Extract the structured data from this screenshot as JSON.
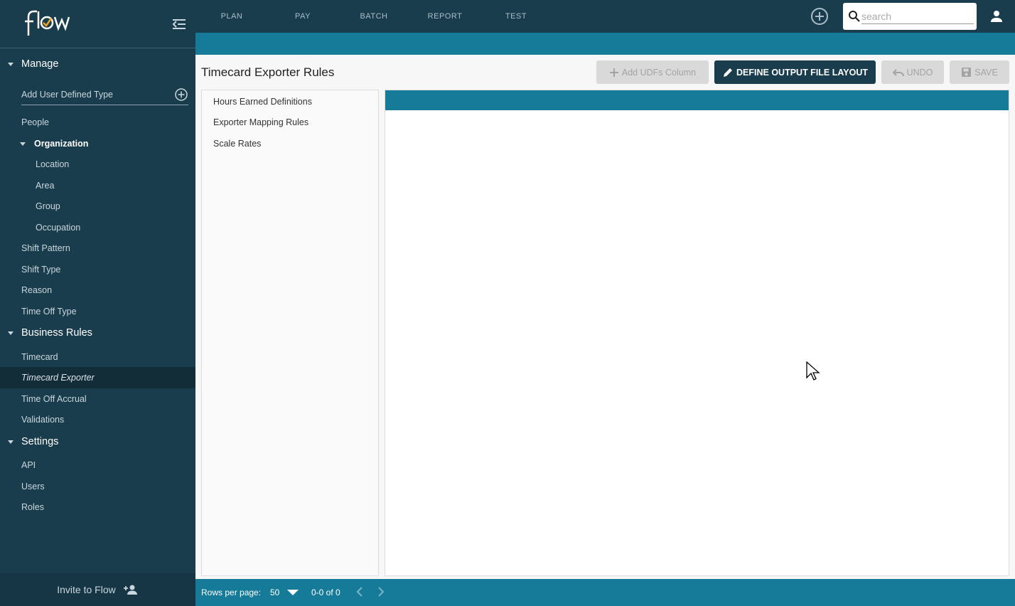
{
  "app": {
    "logo_text": "flow"
  },
  "sidebar": {
    "sections": [
      {
        "label": "Manage"
      },
      {
        "label": "Business Rules"
      },
      {
        "label": "Settings"
      }
    ],
    "add_udt_label": "Add User Defined Type",
    "manage_items": [
      {
        "label": "People"
      },
      {
        "label": "Organization"
      },
      {
        "label": "Location"
      },
      {
        "label": "Area"
      },
      {
        "label": "Group"
      },
      {
        "label": "Occupation"
      },
      {
        "label": "Shift Pattern"
      },
      {
        "label": "Shift Type"
      },
      {
        "label": "Reason"
      },
      {
        "label": "Time Off Type"
      }
    ],
    "business_items": [
      {
        "label": "Timecard"
      },
      {
        "label": "Timecard Exporter"
      },
      {
        "label": "Time Off Accrual"
      },
      {
        "label": "Validations"
      }
    ],
    "settings_items": [
      {
        "label": "API"
      },
      {
        "label": "Users"
      },
      {
        "label": "Roles"
      }
    ],
    "invite_label": "Invite to Flow"
  },
  "topbar": {
    "nav": [
      {
        "label": "PLAN"
      },
      {
        "label": "PAY"
      },
      {
        "label": "BATCH"
      },
      {
        "label": "REPORT"
      },
      {
        "label": "TEST"
      }
    ],
    "search_placeholder": "search"
  },
  "main": {
    "title": "Timecard Exporter Rules",
    "buttons": {
      "add_udfs": "Add UDFs Column",
      "define_layout": "DEFINE OUTPUT FILE LAYOUT",
      "undo": "UNDO",
      "save": "SAVE"
    },
    "left_list": [
      {
        "label": "Hours Earned Definitions"
      },
      {
        "label": "Exporter Mapping Rules"
      },
      {
        "label": "Scale Rates"
      }
    ]
  },
  "footer": {
    "rows_per_page_label": "Rows per page:",
    "rows_per_page_value": "50",
    "range": "0-0 of 0"
  },
  "colors": {
    "sidebar_bg": "#1a3d4e",
    "accent": "#157b98",
    "active_item_bg": "#122c38"
  }
}
